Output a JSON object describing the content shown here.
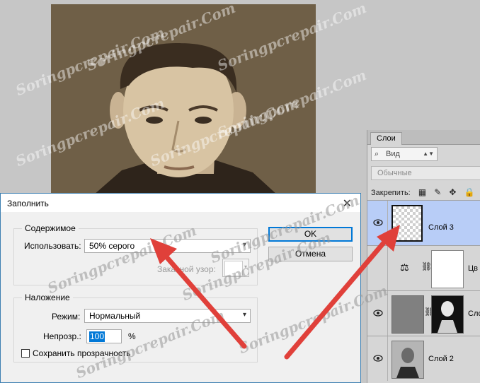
{
  "dialog": {
    "title": "Заполнить",
    "contents_group": {
      "legend": "Содержимое",
      "use_label": "Использовать:",
      "use_value": "50% серого",
      "pattern_label": "Заказной узор:"
    },
    "blending_group": {
      "legend": "Наложение",
      "mode_label": "Режим:",
      "mode_value": "Нормальный",
      "opacity_label": "Непрозр.:",
      "opacity_value": "100",
      "opacity_unit": "%",
      "preserve_label": "Сохранить прозрачность",
      "preserve_checked": false
    },
    "ok_label": "OK",
    "cancel_label": "Отмена"
  },
  "layers_panel": {
    "tab_label": "Слои",
    "filter_value": "Вид",
    "blend_mode": "Обычные",
    "lock_label": "Закрепить:",
    "layers": [
      {
        "name": "Слой 3",
        "selected": true
      },
      {
        "name": "Цв",
        "selected": false
      },
      {
        "name": "Сло",
        "selected": false
      },
      {
        "name": "Слой 2",
        "selected": false
      }
    ]
  },
  "watermark_text": "Soringpcrepair.Com",
  "colors": {
    "accent": "#0078d7",
    "arrow": "#e0403a",
    "photo_bg": "#6f5f47",
    "selected_layer": "#b8cdf7"
  }
}
